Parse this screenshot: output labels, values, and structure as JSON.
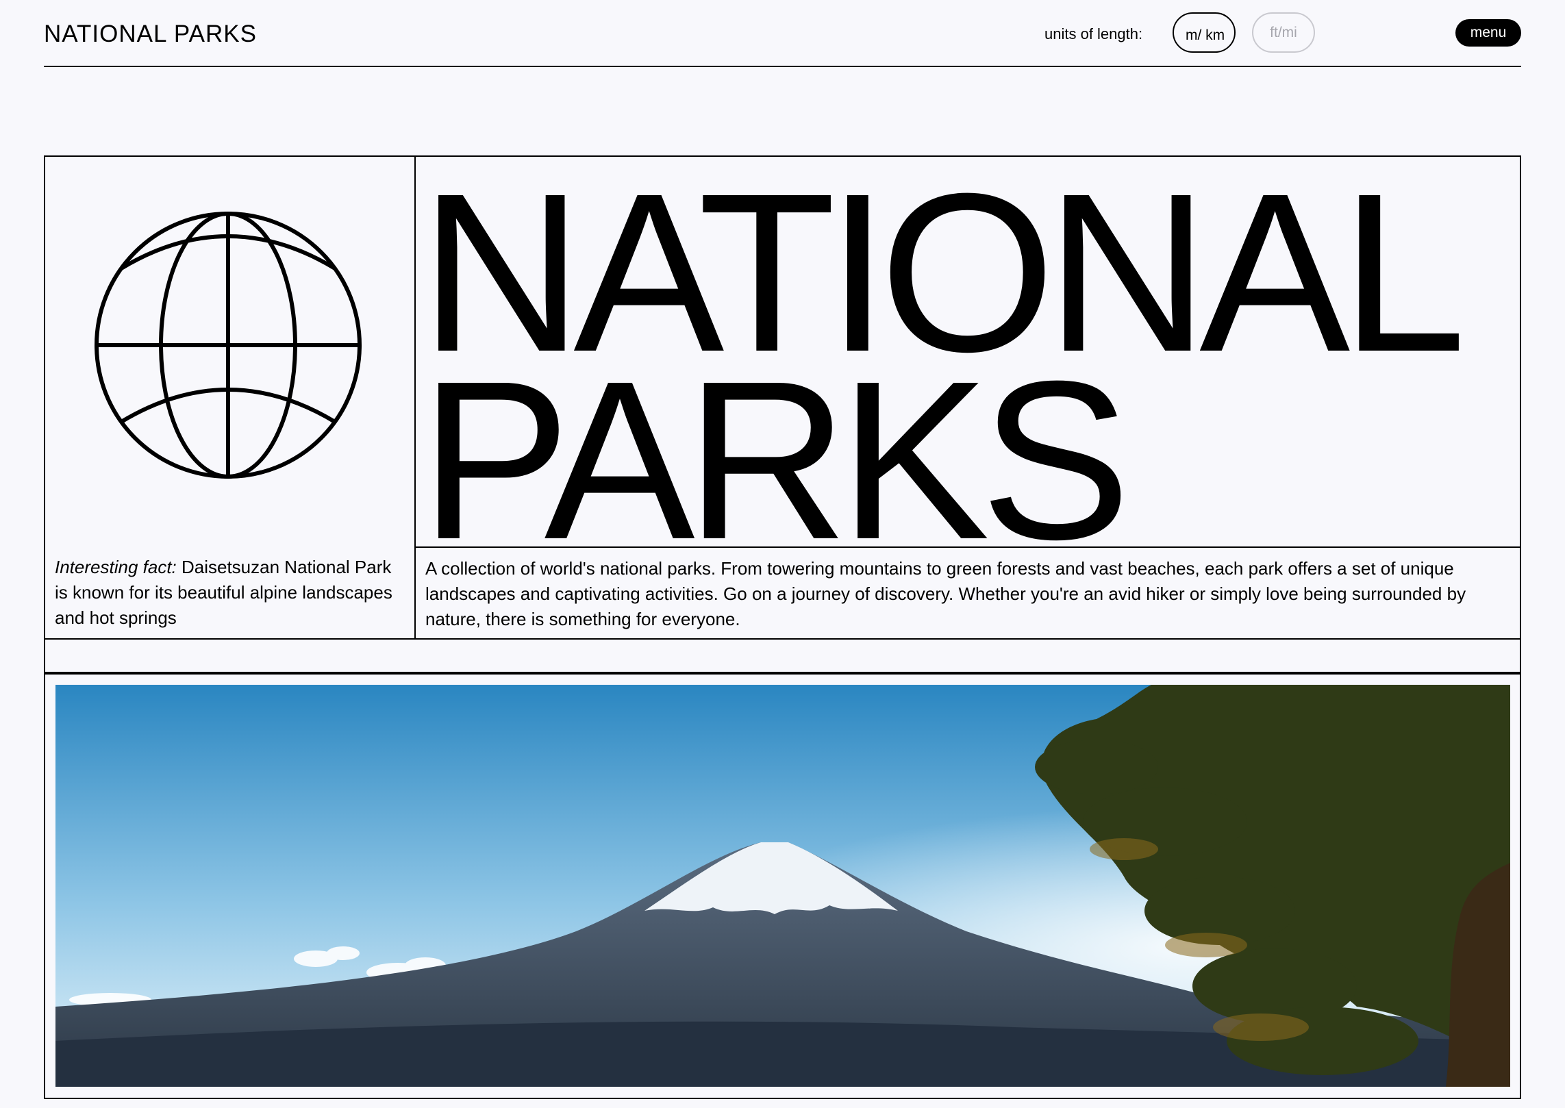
{
  "header": {
    "site_title": "NATIONAL PARKS",
    "units_label": "units of length:",
    "units": [
      {
        "label": "m/ km",
        "active": true
      },
      {
        "label": "ft/mi",
        "active": false
      }
    ],
    "menu_label": "menu"
  },
  "hero": {
    "title_line1": "NATIONAL",
    "title_line2": "PARKS",
    "fact_label": "Interesting fact:",
    "fact_text": " Daisetsuzan National Park is known for its beautiful alpine landscapes and hot springs",
    "description": "A collection of world's national parks. From towering mountains to green forests and vast beaches, each park offers a set of unique landscapes and captivating activities. Go on a journey of discovery. Whether you're an avid hiker or simply love being surrounded by nature, there is something for everyone.",
    "icon": "globe-icon"
  },
  "photo": {
    "subject": "snow-capped volcano with pine tree",
    "colors": {
      "sky_top": "#2a86c1",
      "sky_bottom": "#e9f5fb",
      "mountain": "#3a4a5c",
      "snow": "#eef3f8",
      "tree": "#2f3a16"
    }
  }
}
